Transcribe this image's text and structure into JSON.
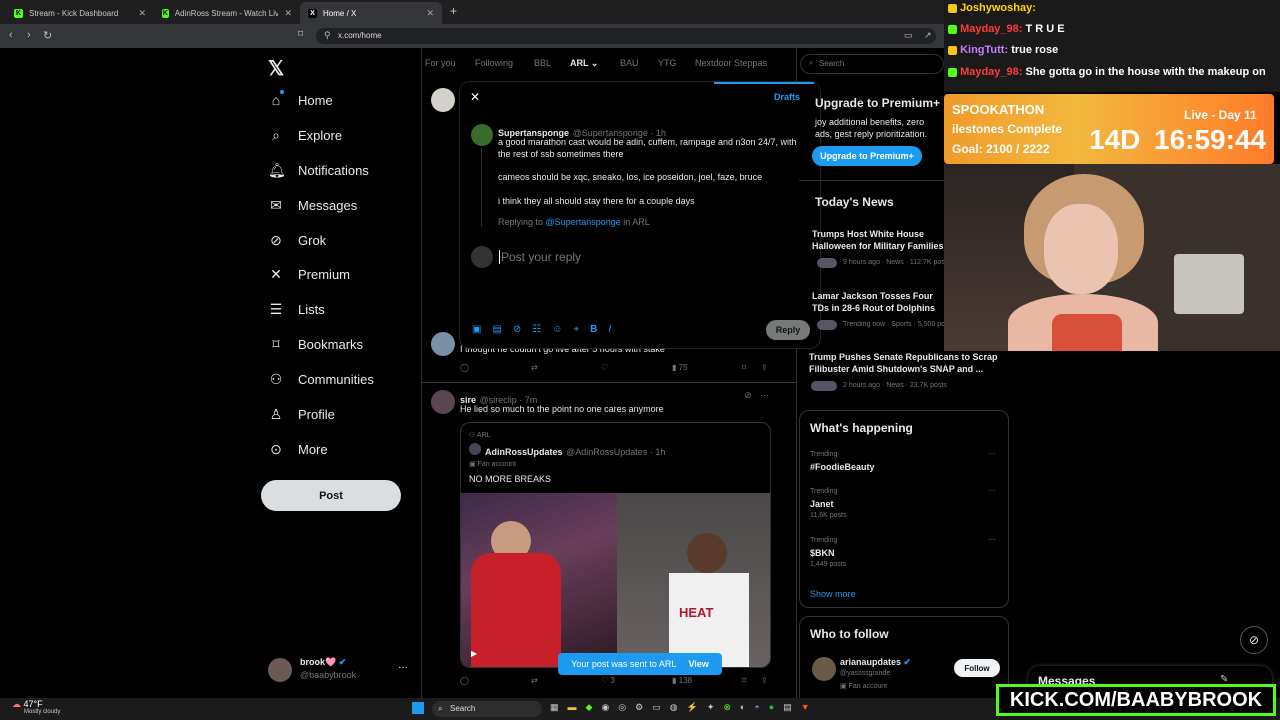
{
  "browser": {
    "tabs": [
      {
        "label": "Stream - Kick Dashboard"
      },
      {
        "label": "AdinRoss Stream - Watch Live on Kick"
      },
      {
        "label": "Home / X"
      }
    ],
    "url": "x.com/home"
  },
  "nav": {
    "items": [
      {
        "label": "Home",
        "icon": "home-icon"
      },
      {
        "label": "Explore",
        "icon": "search-icon"
      },
      {
        "label": "Notifications",
        "icon": "bell-icon"
      },
      {
        "label": "Messages",
        "icon": "envelope-icon"
      },
      {
        "label": "Grok",
        "icon": "grok-icon"
      },
      {
        "label": "Premium",
        "icon": "x-icon"
      },
      {
        "label": "Lists",
        "icon": "list-icon"
      },
      {
        "label": "Bookmarks",
        "icon": "bookmark-icon"
      },
      {
        "label": "Communities",
        "icon": "people-icon"
      },
      {
        "label": "Profile",
        "icon": "person-icon"
      },
      {
        "label": "More",
        "icon": "more-icon"
      }
    ],
    "post_label": "Post",
    "account": {
      "name": "brook🩷",
      "handle": "@baabybrook"
    }
  },
  "timeline_tabs": [
    "For you",
    "Following",
    "BBL",
    "ARL",
    "BAU",
    "YTG",
    "Nextdoor Steppas"
  ],
  "modal": {
    "drafts": "Drafts",
    "author": "Supertansponge",
    "handle": "@Supertansponge · 1h",
    "text1": "a good marathon cast would be adin, cuffem, rampage and n3on 24/7, with the rest of ssb sometimes there",
    "text2": "cameos should be xqc, sneako, los, ice poseidon, joel, faze, bruce",
    "text3": "i think they all should stay there for a couple days",
    "replying_prefix": "Replying to",
    "replying_handle": "@Supertansponge",
    "replying_suffix": "in ARL",
    "placeholder": "Post your reply",
    "reply_btn": "Reply"
  },
  "tweets": [
    {
      "text": "I thought he couldn't go live after 5 hours with stake",
      "views": "75"
    },
    {
      "name": "sire",
      "handle": "@sireclip · 7m",
      "text": "He lied so much to the point no one cares anymore",
      "quote": {
        "community": "ARL",
        "name": "AdinRossUpdates",
        "handle": "@AdinRossUpdates · 1h",
        "badge": "Fan account",
        "text": "NO MORE BREAKS"
      },
      "likes": "3",
      "views": "138",
      "jersey_text": "HEAT"
    }
  ],
  "toast": {
    "text": "Your post was sent to ARL",
    "action": "View"
  },
  "right": {
    "search_placeholder": "Search",
    "premium": {
      "title": "Upgrade to Premium+",
      "desc": "joy additional benefits, zero ads, gest reply prioritization.",
      "btn": "Upgrade to Premium+"
    },
    "news_title": "Today's News",
    "news": [
      {
        "title": "Trumps Host White House Halloween for Military Families Amid Shutdown",
        "meta": "9 hours ago · News · 112.7K posts"
      },
      {
        "title": "Lamar Jackson Tosses Four TDs in 28-6 Rout of Dolphins",
        "meta": "Trending now · Sports · 5,500 posts"
      },
      {
        "title": "Trump Pushes Senate Republicans to Scrap Filibuster Amid Shutdown's SNAP and ...",
        "meta": "2 hours ago · News · 23.7K posts"
      }
    ],
    "happening_title": "What's happening",
    "trends": [
      {
        "label": "Trending",
        "name": "#FoodieBeauty",
        "count": ""
      },
      {
        "label": "Trending",
        "name": "Janet",
        "count": "11.6K posts"
      },
      {
        "label": "Trending",
        "name": "$BKN",
        "count": "1,449 posts"
      }
    ],
    "show_more": "Show more",
    "who_title": "Who to follow",
    "follow": {
      "name": "arianaupdates",
      "handle": "@yassssgrande",
      "badge": "Fan account",
      "btn": "Follow"
    },
    "messages": "Messages"
  },
  "stream": {
    "chat": [
      {
        "user": "Joshywoshay:",
        "msg": "",
        "color": "#ffd700"
      },
      {
        "user": "Mayday_98:",
        "msg": "T R U E",
        "color": "#ff3b3b"
      },
      {
        "user": "KingTutt:",
        "msg": "true rose",
        "color": "#c77dff"
      },
      {
        "user": "Mayday_98:",
        "msg": "She gotta go in the house with the makeup on",
        "color": "#ff3b3b"
      }
    ],
    "banner": {
      "event": "SPOOKATHON",
      "sub": "ilestones Complete",
      "goal": "Goal: 2100 / 2222",
      "live": "Live - Day 11",
      "timer_days": "14D",
      "timer_time": "16:59:44"
    },
    "kick_logo": "KICK.COM/BAABYBROOK"
  },
  "taskbar": {
    "weather_temp": "47°F",
    "weather_desc": "Mostly cloudy",
    "search": "Search"
  }
}
